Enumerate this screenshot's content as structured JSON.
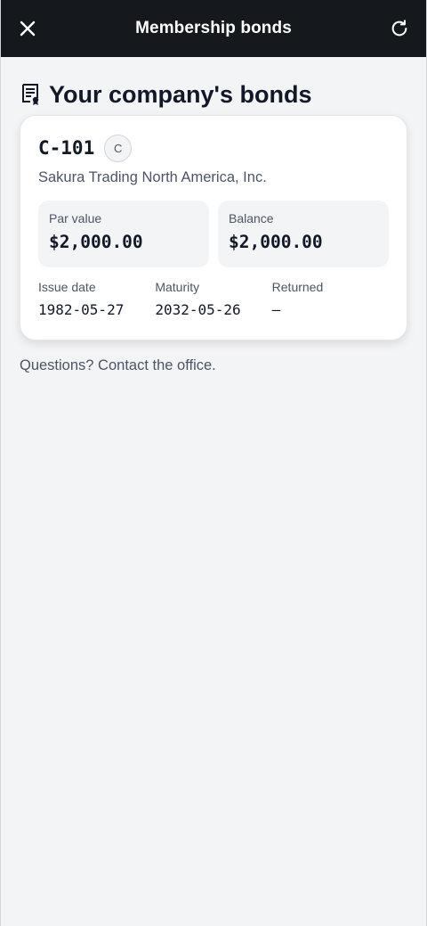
{
  "header": {
    "title": "Membership bonds",
    "close_icon": "close-icon",
    "refresh_icon": "refresh-icon",
    "background_color": "#15181d"
  },
  "section": {
    "title": "Your company's bonds",
    "icon": "document-certificate-icon"
  },
  "bonds": [
    {
      "code": "C-101",
      "class_badge": "C",
      "company": "Sakura Trading North America, Inc.",
      "par_value_label": "Par value",
      "par_value": "$2,000.00",
      "balance_label": "Balance",
      "balance": "$2,000.00",
      "issue_date_label": "Issue date",
      "issue_date": "1982-05-27",
      "maturity_label": "Maturity",
      "maturity": "2032-05-26",
      "returned_label": "Returned",
      "returned": "—"
    }
  ],
  "footer": {
    "note": "Questions? Contact the office."
  }
}
